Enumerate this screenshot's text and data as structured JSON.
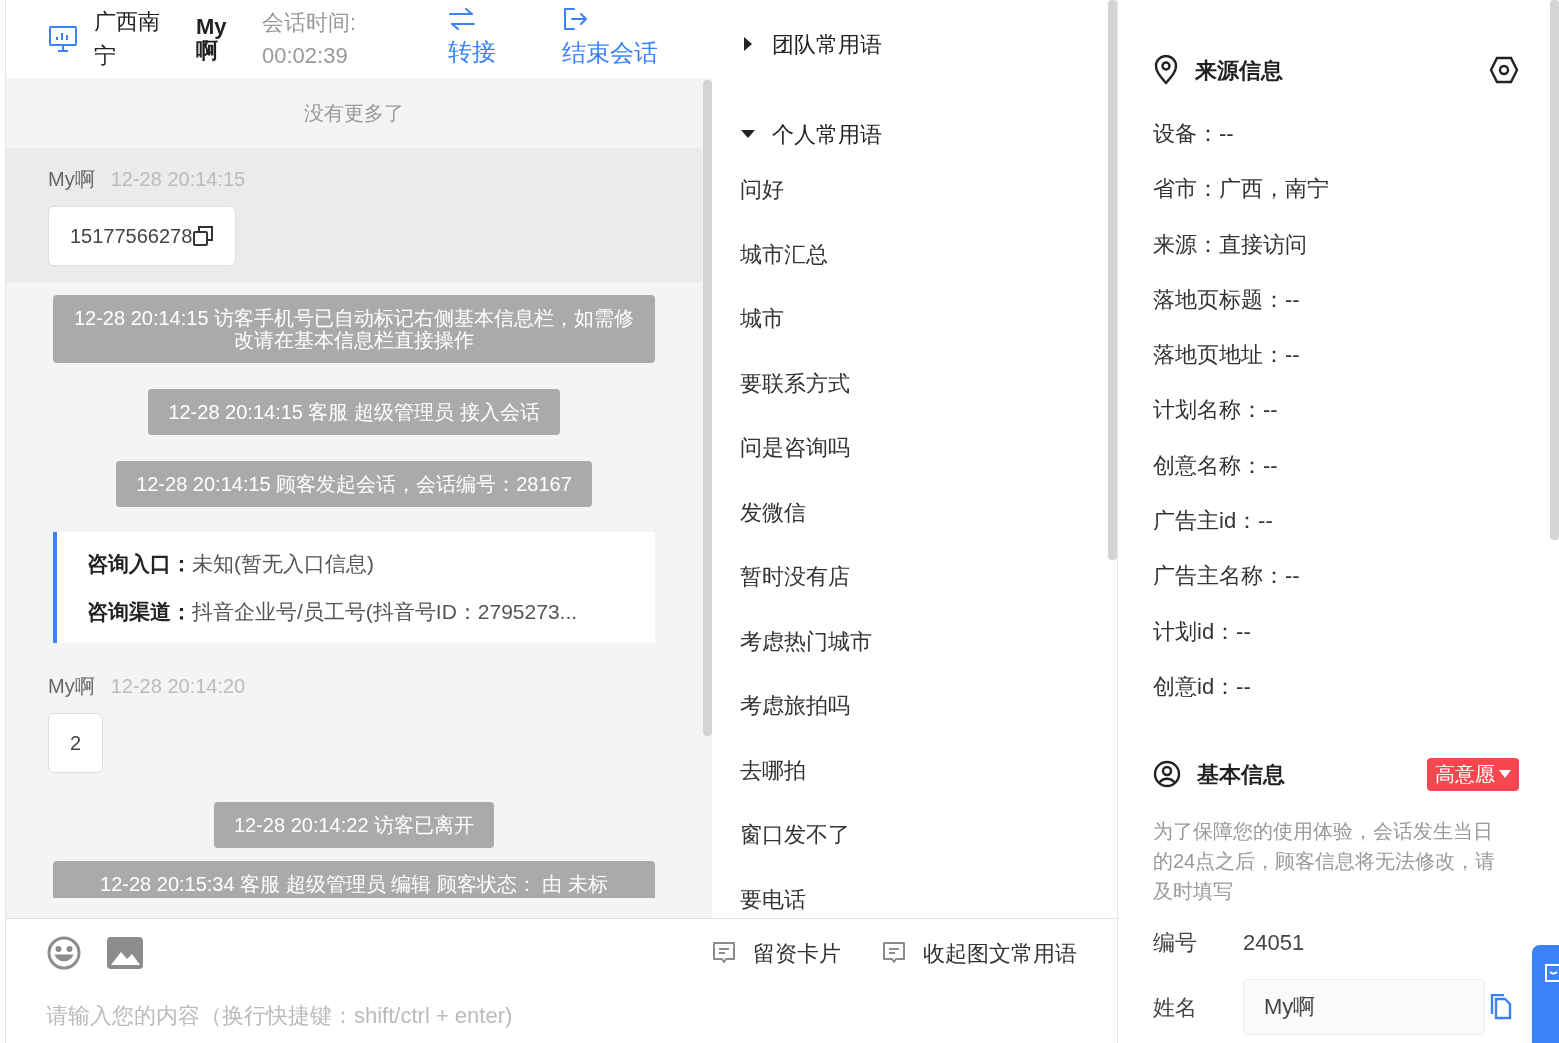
{
  "header": {
    "location": "广西南宁",
    "visitor": "My啊",
    "timer_label": "会话时间:",
    "timer": "00:02:39",
    "actions": [
      {
        "label": "转接",
        "kind": "transfer"
      },
      {
        "label": "结束会话",
        "kind": "end"
      }
    ]
  },
  "chat": {
    "no_more": "没有更多了",
    "messages": [
      {
        "kind": "visitor",
        "name": "My啊",
        "time": "12-28 20:14:15",
        "text": "15177566278",
        "copy": true,
        "selected": true
      },
      {
        "kind": "system",
        "text": "12-28 20:14:15 访客手机号已自动标记右侧基本信息栏，如需修改请在基本信息栏直接操作"
      },
      {
        "kind": "system",
        "text": "12-28 20:14:15 客服 超级管理员 接入会话"
      },
      {
        "kind": "system",
        "text": "12-28 20:14:15 顾客发起会话，会话编号：28167"
      },
      {
        "kind": "source",
        "rows": [
          {
            "label": "咨询入口：",
            "value": "未知(暂无入口信息)"
          },
          {
            "label": "咨询渠道：",
            "value": "抖音企业号/员工号(抖音号ID：2795273..."
          }
        ]
      },
      {
        "kind": "visitor",
        "name": "My啊",
        "time": "12-28 20:14:20",
        "text": "2",
        "copy": false,
        "selected": false
      },
      {
        "kind": "system",
        "text": "12-28 20:14:22 访客已离开"
      },
      {
        "kind": "system",
        "text": "12-28 20:15:34 客服 超级管理员 编辑 顾客状态： 由 未标",
        "cut": true
      }
    ]
  },
  "phrases": {
    "groups": [
      {
        "title": "团队常用语",
        "expanded": false
      },
      {
        "title": "个人常用语",
        "expanded": true,
        "items": [
          "问好",
          "城市汇总",
          "城市",
          "要联系方式",
          "问是咨询吗",
          "发微信",
          "暂时没有店",
          "考虑热门城市",
          "考虑旅拍吗",
          "去哪拍",
          "窗口发不了",
          "要电话"
        ]
      }
    ]
  },
  "composer": {
    "placeholder": "请输入您的内容（换行快捷键：shift/ctrl + enter)",
    "tools": [
      "留资卡片",
      "收起图文常用语"
    ]
  },
  "source_info": {
    "title": "来源信息",
    "fields": [
      "设备：--",
      "省市：广西，南宁",
      "来源：直接访问",
      "落地页标题：--",
      "落地页地址：--",
      "计划名称：--",
      "创意名称：--",
      "广告主id：--",
      "广告主名称：--",
      "计划id：--",
      "创意id：--"
    ]
  },
  "basic_info": {
    "title": "基本信息",
    "tag": {
      "label": "高意愿",
      "color": "#f5474f"
    },
    "notice": "为了保障您的使用体验，会话发生当日的24点之后，顾客信息将无法修改，请及时填写",
    "fields": [
      {
        "kind": "text",
        "label": "编号",
        "value": "24051"
      },
      {
        "kind": "input",
        "label": "姓名",
        "value": "My啊"
      }
    ]
  }
}
